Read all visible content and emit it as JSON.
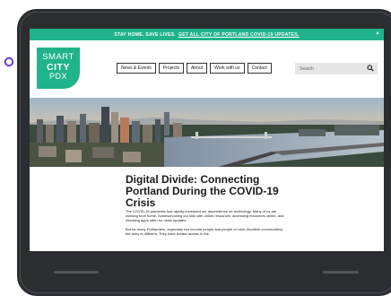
{
  "banner": {
    "text": "STAY HOME. SAVE LIVES.",
    "link": "GET ALL CITY OF PORTLAND COVID-19 UPDATES.",
    "close": "×"
  },
  "logo": {
    "line1": "SMART",
    "line2": "CITY",
    "line3": "PDX"
  },
  "nav": {
    "items": [
      "News & Events",
      "Projects",
      "About",
      "Work with us",
      "Contact"
    ]
  },
  "search": {
    "placeholder": "Search"
  },
  "article": {
    "title": "Digital Divide: Connecting Portland During the COVID-19 Crisis",
    "p1": "The COVID-19 pandemic has rapidly increased our dependence on technology. Many of us are working from home, homeschooling our kids with online resources, accessing resources online, and checking apps often for news updates.",
    "p2_start": "But for many Portlanders, especially low income people and people of color",
    "p2_em": "(frontline communities)",
    "p2_end": ", the story is different. They have limited access to the"
  },
  "colors": {
    "accent": "#20b38c",
    "device": "#2b2d31"
  }
}
